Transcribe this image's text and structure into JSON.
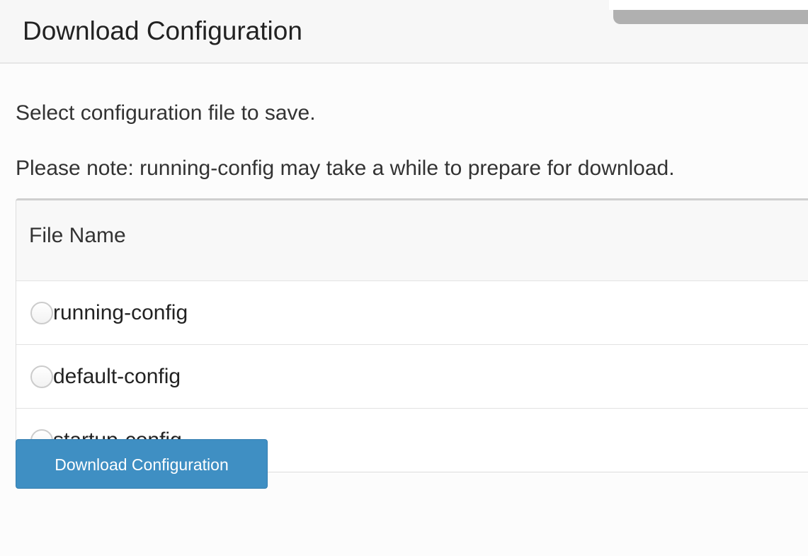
{
  "header": {
    "title": "Download Configuration"
  },
  "content": {
    "instruction": "Select configuration file to save.",
    "note": "Please note: running-config may take a while to prepare for download."
  },
  "table": {
    "column_header": "File Name",
    "rows": [
      {
        "label": "running-config",
        "selected": false
      },
      {
        "label": "default-config",
        "selected": false
      },
      {
        "label": "startup-config",
        "selected": false
      }
    ]
  },
  "actions": {
    "download_label": "Download Configuration"
  },
  "colors": {
    "button_primary": "#3f8fc3",
    "header_bg": "#f7f7f7"
  }
}
